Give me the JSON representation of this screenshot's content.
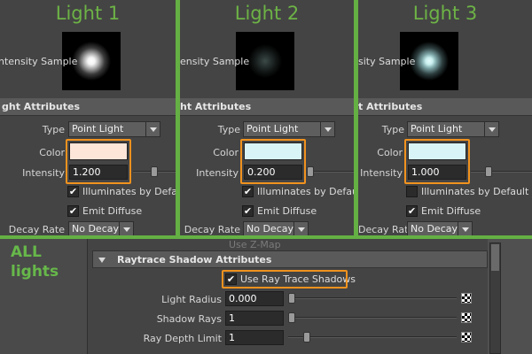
{
  "panels": [
    {
      "title": "Light 1",
      "sample_label": "ntensity Sample",
      "section": "ght Attributes",
      "type_label": "Type",
      "type_value": "Point Light",
      "color_label": "Color",
      "color_hex": "#fde5d8",
      "intensity_label": "Intensity",
      "intensity_value": "1.200",
      "illum_label": "Illuminates by Default",
      "illum_checked": "✔",
      "emit_label": "Emit Diffuse",
      "emit_checked": "✔",
      "decay_label": "Decay Rate",
      "decay_value": "No Decay"
    },
    {
      "title": "Light 2",
      "sample_label": "ensity Sample",
      "section": "ht Attributes",
      "type_label": "Type",
      "type_value": "Point Light",
      "color_label": "Color",
      "color_hex": "#d8f4f6",
      "intensity_label": "Intensity",
      "intensity_value": "0.200",
      "illum_label": "Illuminates by Default",
      "illum_checked": "✔",
      "emit_label": "Emit Diffuse",
      "emit_checked": "✔",
      "decay_label": "Decay Rate",
      "decay_value": "No Decay"
    },
    {
      "title": "Light 3",
      "sample_label": "sity Sample",
      "section": "t Attributes",
      "type_label": "Type",
      "type_value": "Point Light",
      "color_label": "Color",
      "color_hex": "#d8f4f6",
      "intensity_label": "Intensity",
      "intensity_value": "1.000",
      "illum_label": "Illuminates by Default",
      "illum_checked": "",
      "emit_label": "Emit Diffuse",
      "emit_checked": "✔",
      "decay_label": "Decay Rate",
      "decay_value": "No Decay"
    }
  ],
  "all_lights": {
    "line1": "ALL",
    "line2": "lights"
  },
  "faded_row": "Use Z-Map",
  "raytrace": {
    "header": "Raytrace Shadow Attributes",
    "use_label": "Use Ray Trace Shadows",
    "use_checked": "✔",
    "light_radius_label": "Light Radius",
    "light_radius_value": "0.000",
    "shadow_rays_label": "Shadow Rays",
    "shadow_rays_value": "1",
    "ray_depth_label": "Ray Depth Limit",
    "ray_depth_value": "1"
  },
  "accent_green": "#64b044",
  "accent_orange": "#f0921e"
}
